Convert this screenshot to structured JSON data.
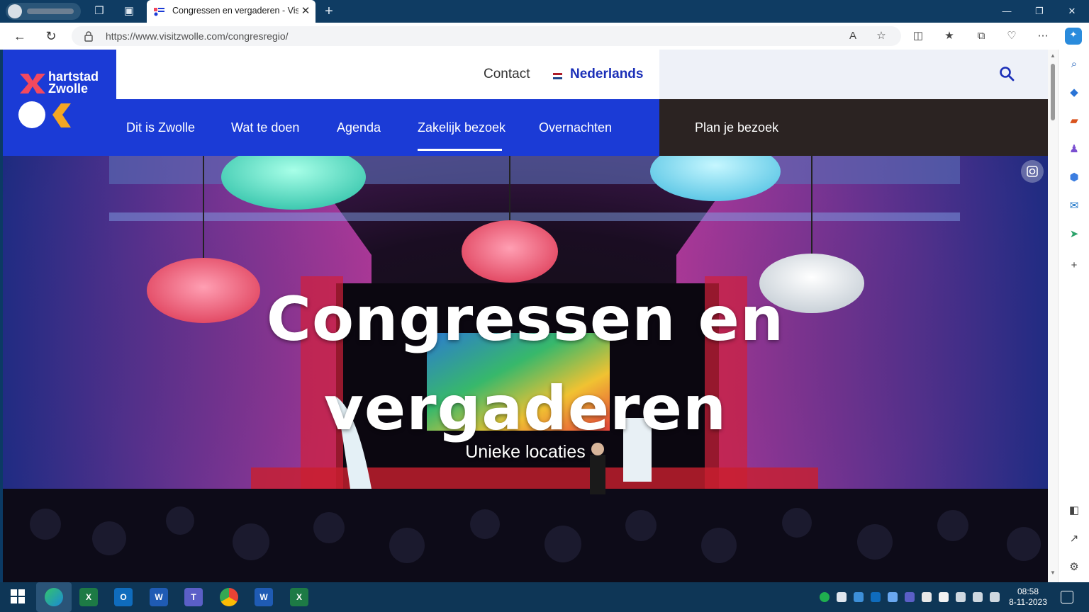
{
  "browser": {
    "tab_title": "Congressen en vergaderen - Visit Zwolle",
    "url": "https://www.visitzwolle.com/congresregio/"
  },
  "site": {
    "logo": {
      "line1": "hartstad",
      "line2": "Zwolle",
      "colors": {
        "x": "#f2495f",
        "heart": "#f5a623",
        "circle": "#ffffff"
      }
    },
    "top": {
      "contact": "Contact",
      "language": "Nederlands"
    },
    "nav": {
      "items": [
        "Dit is Zwolle",
        "Wat te doen",
        "Agenda",
        "Zakelijk bezoek",
        "Overnachten"
      ],
      "active": "Zakelijk bezoek",
      "cta": "Plan je bezoek"
    },
    "hero": {
      "title_line1": "Congressen en",
      "title_line2": "vergaderen",
      "subtitle": "Unieke locaties"
    },
    "colors": {
      "brand_blue": "#1b3bd6",
      "dark": "#2b2322"
    }
  },
  "taskbar": {
    "time": "08:58",
    "date": "8-11-2023"
  }
}
